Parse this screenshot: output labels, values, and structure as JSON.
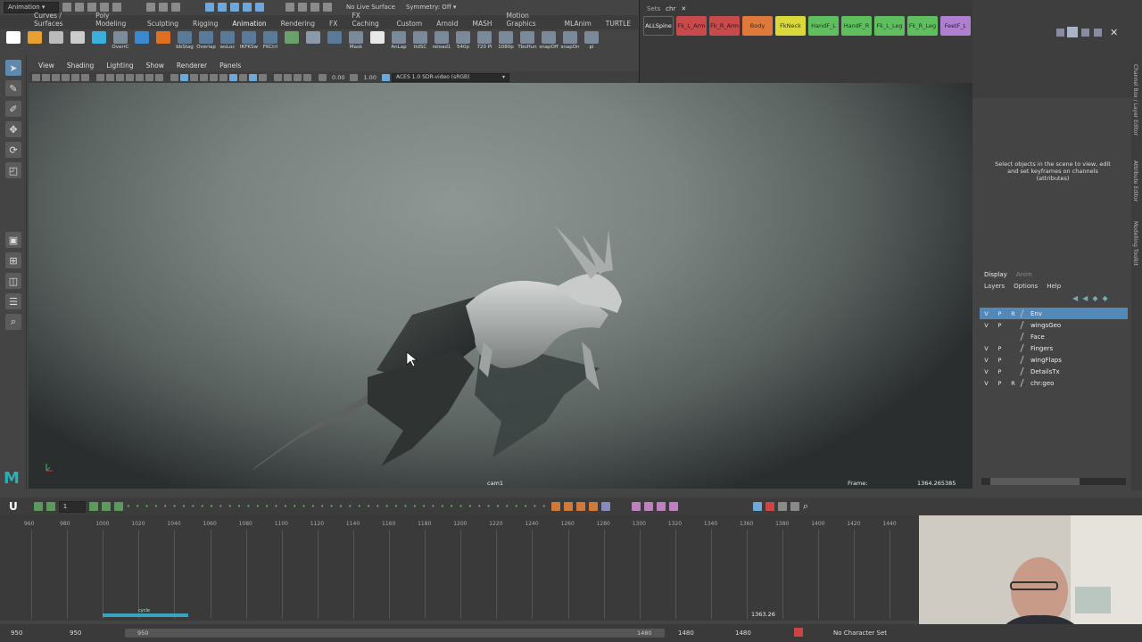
{
  "status_line": {
    "mode_menu": "Animation",
    "live_surface": "No Live Surface",
    "symmetry": "Symmetry: Off"
  },
  "shelf_tabs": [
    "Curves / Surfaces",
    "Poly Modeling",
    "Sculpting",
    "Rigging",
    "Animation",
    "Rendering",
    "FX",
    "FX Caching",
    "Custom",
    "Arnold",
    "MASH",
    "Motion Graphics",
    "MLAnim",
    "TURTLE"
  ],
  "shelf_items": [
    "",
    "",
    "",
    "",
    "",
    "OverrC",
    "",
    "",
    "bbStag",
    "Overlap",
    "wsLoc",
    "IKFKSw",
    "FKCtrl",
    "",
    "",
    "",
    "Mask",
    "",
    "AnLap",
    "tidSC",
    "reload1",
    "540p",
    "720 Pl",
    "1080p",
    "TboHun",
    "snapOff",
    "snapOn",
    "pl"
  ],
  "selection_sets": {
    "tabs": [
      "Sets",
      "chr"
    ],
    "buttons": [
      {
        "label": "ALLSpine",
        "color": "#3a3a3a",
        "text": "#eeeeee"
      },
      {
        "label": "Fk_L_Arm",
        "color": "#c94a4a",
        "text": "#3b1010"
      },
      {
        "label": "Fk_R_Arm",
        "color": "#c94a4a",
        "text": "#3b1010"
      },
      {
        "label": "Body",
        "color": "#e07a3a",
        "text": "#4b2508"
      },
      {
        "label": "FkNeck",
        "color": "#d9d93a",
        "text": "#333308"
      },
      {
        "label": "HandF_L",
        "color": "#5fbf5f",
        "text": "#173817"
      },
      {
        "label": "HandF_R",
        "color": "#5fbf5f",
        "text": "#173817"
      },
      {
        "label": "Fk_L_Leg",
        "color": "#5fbf5f",
        "text": "#173817"
      },
      {
        "label": "Fk_R_Leg",
        "color": "#5fbf5f",
        "text": "#173817"
      },
      {
        "label": "FeetF_L",
        "color": "#b07fd0",
        "text": "#2d1640"
      },
      {
        "label": "FeetF_R",
        "color": "#b07fd0",
        "text": "#2d1640"
      },
      {
        "label": "Tail1",
        "color": "#b07fd0",
        "text": "#2d1640"
      }
    ]
  },
  "viewport": {
    "menus": [
      "View",
      "Shading",
      "Lighting",
      "Show",
      "Renderer",
      "Panels"
    ],
    "exposure": "0.00",
    "gamma": "1.00",
    "color_space": "ACES 1.0 SDR-video (sRGB)",
    "camera": "cam1",
    "frame_label": "Frame:",
    "frame_value": "1364.265385"
  },
  "channel_box": {
    "message": "Select objects in the scene to view, edit and set keyframes on channels (attributes)"
  },
  "side_tabs": [
    "Channel Box / Layer Editor",
    "Attribute Editor",
    "Modelling Toolkit"
  ],
  "layer_editor": {
    "tabs": [
      "Display",
      "Anim"
    ],
    "menus": [
      "Layers",
      "Options",
      "Help"
    ],
    "layers": [
      {
        "v": "V",
        "p": "P",
        "r": "R",
        "name": "Env",
        "selected": true
      },
      {
        "v": "V",
        "p": "P",
        "r": "",
        "name": "wingsGeo",
        "selected": false
      },
      {
        "v": "",
        "p": "",
        "r": "",
        "name": "Face",
        "selected": false
      },
      {
        "v": "V",
        "p": "P",
        "r": "",
        "name": "Fingers",
        "selected": false
      },
      {
        "v": "V",
        "p": "P",
        "r": "",
        "name": "wingFlaps",
        "selected": false
      },
      {
        "v": "V",
        "p": "P",
        "r": "",
        "name": "DetailsTx",
        "selected": false
      },
      {
        "v": "V",
        "p": "P",
        "r": "R",
        "name": "chr:geo",
        "selected": false
      }
    ]
  },
  "time_slider": {
    "tool_value": "1",
    "ticks": [
      "960",
      "980",
      "1000",
      "1020",
      "1040",
      "1060",
      "1080",
      "1100",
      "1120",
      "1140",
      "1160",
      "1180",
      "1200",
      "1220",
      "1240",
      "1260",
      "1280",
      "1300",
      "1320",
      "1340",
      "1360",
      "1380",
      "1400",
      "1420",
      "1440"
    ],
    "current_time": "1363.26",
    "cache_label": "cycle"
  },
  "range_slider": {
    "start": "950",
    "anim_start": "950",
    "range_start": "950",
    "range_end": "1480",
    "anim_end": "1480",
    "end": "1480",
    "character_set": "No Character Set"
  }
}
